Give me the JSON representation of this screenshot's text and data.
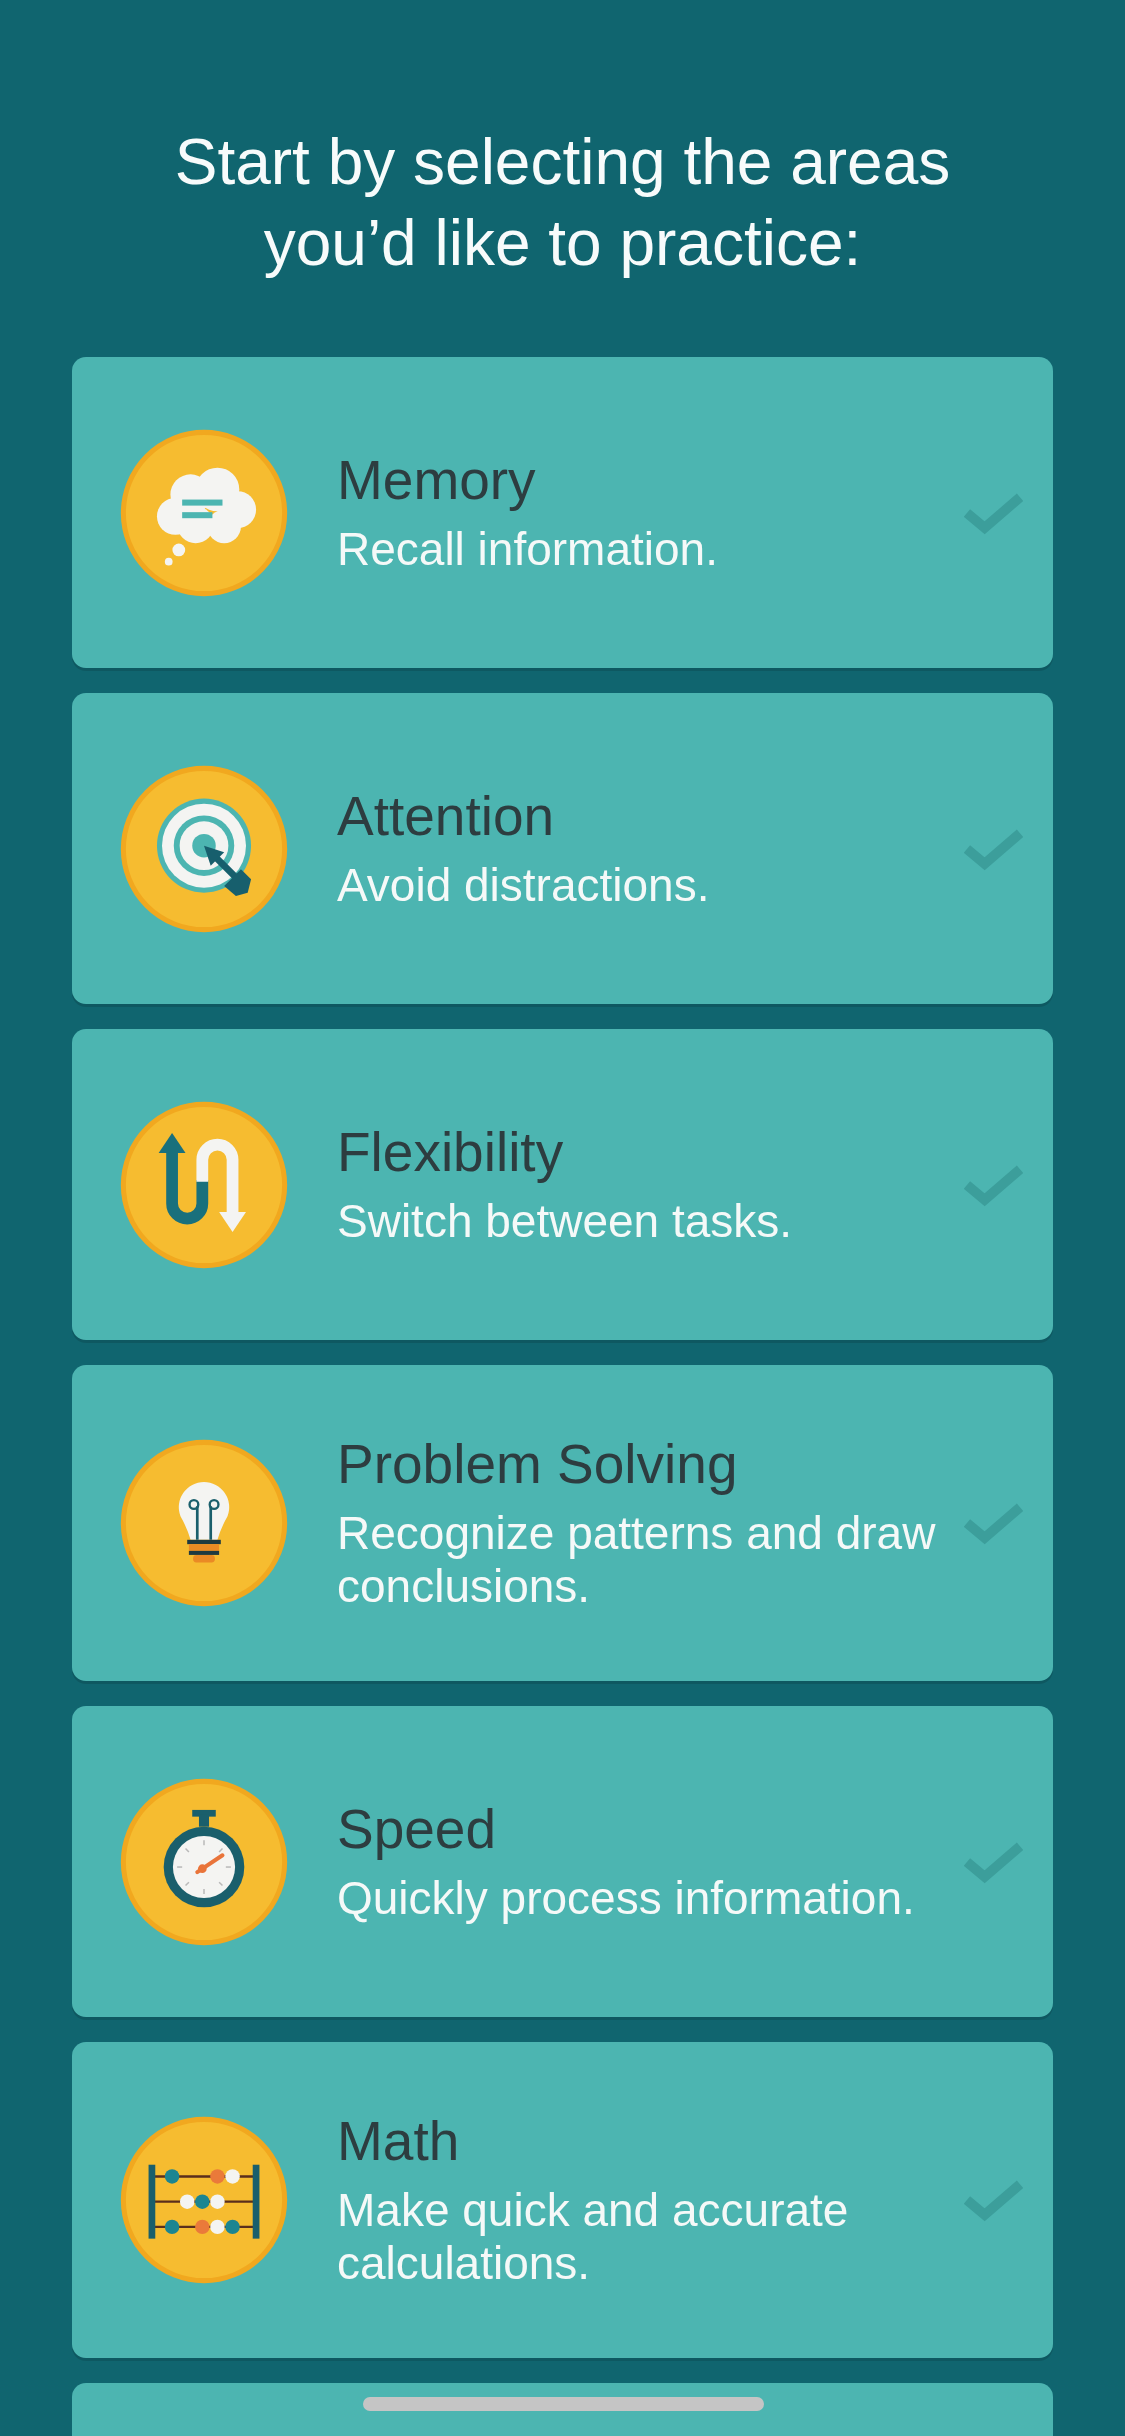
{
  "heading": "Start by selecting the areas you’d like to practice:",
  "areas": [
    {
      "name": "Memory",
      "description": "Recall information.",
      "selected": false
    },
    {
      "name": "Attention",
      "description": "Avoid distractions.",
      "selected": false
    },
    {
      "name": "Flexibility",
      "description": "Switch between tasks.",
      "selected": false
    },
    {
      "name": "Problem Solving",
      "description": "Recognize patterns and draw conclusions.",
      "selected": false
    },
    {
      "name": "Speed",
      "description": "Quickly process information.",
      "selected": false
    },
    {
      "name": "Math",
      "description": "Make quick and accurate calculations.",
      "selected": false
    }
  ]
}
